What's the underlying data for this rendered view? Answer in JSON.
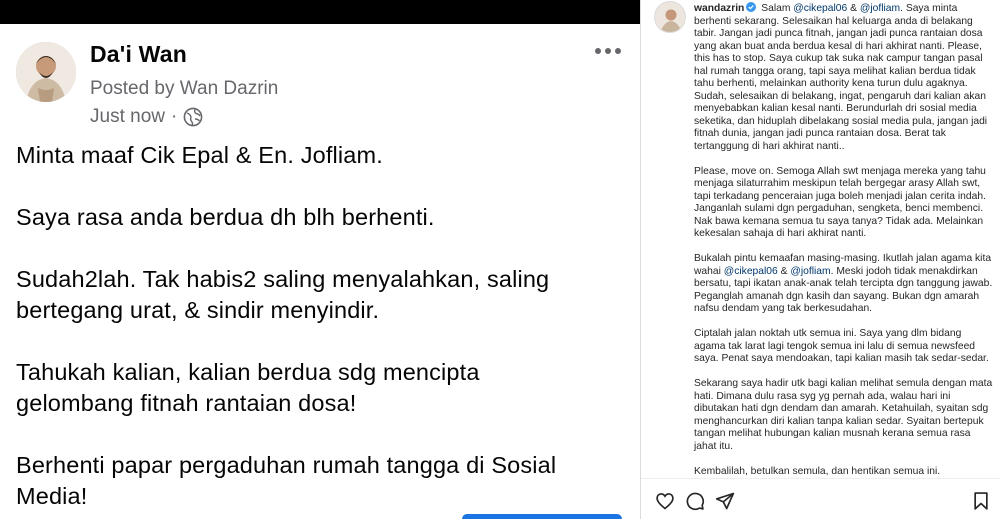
{
  "fb_post": {
    "author_name": "Da'i Wan",
    "posted_by": "Posted by Wan Dazrin",
    "timestamp": "Just now",
    "separator": "·",
    "privacy_icon": "globe-icon",
    "more_icon": "more-options-icon",
    "body": [
      "Minta maaf Cik Epal & En. Jofliam.",
      "Saya rasa anda berdua dh blh berhenti.",
      "Sudah2lah. Tak habis2 saling menyalahkan, saling\nbertegang urat, & sindir menyindir.",
      "Tahukah kalian, kalian berdua sdg mencipta\ngelombang fitnah rantaian dosa!",
      "Berhenti papar pergaduhan rumah tangga di Sosial\nMedia!"
    ]
  },
  "ig_post": {
    "username": "wandazrin",
    "caption_lead": "Salam",
    "mention_1": "@cikepal06",
    "amp": "&",
    "mention_2": "@jofliam",
    "para1_rest": ". Saya minta berhenti sekarang. Selesaikan hal keluarga anda di belakang tabir. Jangan jadi punca fitnah, jangan jadi punca rantaian dosa yang akan buat anda berdua kesal di hari akhirat nanti. Please, this has to stop. Saya cukup tak suka nak campur tangan pasal hal rumah tangga orang, tapi saya melihat kalian berdua tidak tahu berhenti, melainkan authority kena turun dulu agaknya. Sudah, selesaikan di belakang, ingat, pengaruh dari kalian akan menyebabkan kalian kesal nanti. Berundurlah dri sosial media seketika, dan hiduplah dibelakang sosial media pula, jangan jadi fitnah dunia, jangan jadi punca rantaian dosa. Berat tak tertanggung di hari akhirat nanti..",
    "para2": "Please, move on. Semoga Allah swt menjaga mereka yang tahu menjaga silaturrahim meskipun telah bergegar arasy Allah swt, tapi terkadang penceraian juga boleh menjadi jalan cerita indah. Janganlah sulami dgn pergaduhan, sengketa, benci membenci. Nak bawa kemana semua tu saya tanya? Tidak ada. Melainkan kekesalan sahaja di hari akhirat nanti.",
    "para3_lead": "Bukalah pintu kemaafan masing-masing. Ikutlah jalan agama kita wahai",
    "para3_rest": ". Meski jodoh tidak menakdirkan bersatu, tapi ikatan anak-anak telah tercipta dgn tanggung jawab. Peganglah amanah dgn kasih dan sayang. Bukan dgn amarah nafsu dendam yang tak berkesudahan.",
    "para4": "Ciptalah jalan noktah utk semua ini. Saya yang dlm bidang agama tak larat lagi tengok semua ini lalu di semua newsfeed saya. Penat saya mendoakan, tapi kalian masih tak sedar-sedar.",
    "para5": "Sekarang saya hadir utk bagi kalian melihat semula dengan mata hati. Dimana dulu rasa syg yg pernah ada, walau hari ini dibutakan hati dgn dendam dan amarah. Ketahuilah, syaitan sdg menghancurkan diri kalian tanpa kalian sedar. Syaitan bertepuk tangan melihat hubungan kalian musnah kerana semua rasa jahat itu.",
    "para6": "Kembalilah, betulkan semula, dan hentikan semua ini.",
    "action_icons": [
      "heart-icon",
      "comment-icon",
      "share-icon",
      "bookmark-icon"
    ],
    "colors": {
      "mention": "#00376b",
      "verified": "#3897f0",
      "text": "#262626"
    }
  }
}
